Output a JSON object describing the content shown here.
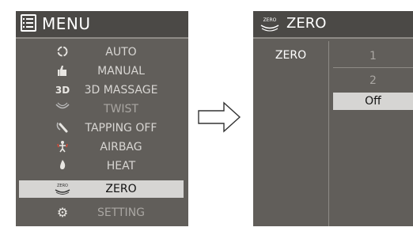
{
  "menu": {
    "title": "MENU",
    "items": [
      {
        "label": "AUTO",
        "icon": "auto-icon",
        "glyph": "◌"
      },
      {
        "label": "MANUAL",
        "icon": "hand-icon",
        "glyph": ""
      },
      {
        "label": "3D MASSAGE",
        "icon": "3d-icon",
        "glyph": "3D"
      },
      {
        "label": "TWIST",
        "icon": "twist-icon",
        "glyph": ""
      },
      {
        "label": "TAPPING OFF",
        "icon": "tapping-icon",
        "glyph": ""
      },
      {
        "label": "AIRBAG",
        "icon": "airbag-icon",
        "glyph": ""
      },
      {
        "label": "HEAT",
        "icon": "heat-icon",
        "glyph": ""
      },
      {
        "label": "ZERO",
        "icon": "zero-gravity-icon",
        "glyph": "ZERO",
        "selected": true
      },
      {
        "label": "SETTING",
        "icon": "gear-icon",
        "glyph": "⚙"
      }
    ]
  },
  "zero": {
    "title": "ZERO",
    "header_icon_text": "ZERO",
    "column_label": "ZERO",
    "options": [
      {
        "label": "1"
      },
      {
        "label": "2"
      },
      {
        "label": "Off",
        "selected": true
      }
    ]
  },
  "colors": {
    "panel": "#615e5a",
    "header": "#4b4946",
    "selected": "#d6d5d3"
  }
}
